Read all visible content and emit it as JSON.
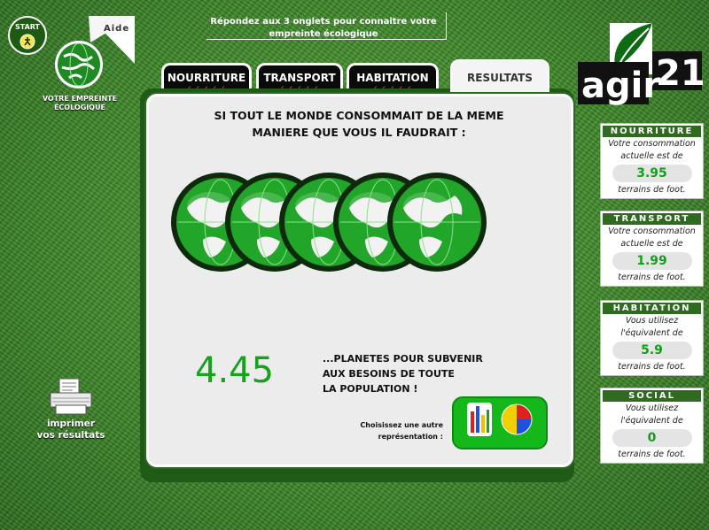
{
  "header": {
    "start_label": "START",
    "aide_label": "Aide",
    "empreinte_label": "VOTRE EMPREINTE ÉCOLOGIQUE",
    "instruction": "Répondez aux 3 onglets pour connaitre votre empreinte écologique"
  },
  "tabs": [
    {
      "label": "NOURRITURE",
      "checks": "✓✓✓✓✓"
    },
    {
      "label": "TRANSPORT",
      "checks": "✓✓✓✓✓"
    },
    {
      "label": "HABITATION",
      "checks": "✓✓✓✓✓"
    },
    {
      "label": "RESULTATS"
    }
  ],
  "main": {
    "title_line1": "SI TOUT LE MONDE CONSOMMAIT DE LA MEME",
    "title_line2": "MANIERE QUE VOUS IL FAUDRAIT :",
    "planets_value": "4.45",
    "planets_count": 4.45,
    "planets_text_1": "...PLANETES POUR SUBVENIR",
    "planets_text_2": "AUX BESOINS DE TOUTE",
    "planets_text_3": "LA POPULATION !",
    "choose_line1": "Choisissez une autre",
    "choose_line2": "représentation :"
  },
  "print": {
    "line1": "imprimer",
    "line2": "vos résultats"
  },
  "logo": {
    "text": "agir 21"
  },
  "cards": [
    {
      "title": "NOURRITURE",
      "line1": "Votre consommation",
      "line2": "actuelle est de",
      "value": "3.95",
      "unit": "terrains de foot."
    },
    {
      "title": "TRANSPORT",
      "line1": "Votre consommation",
      "line2": "actuelle est de",
      "value": "1.99",
      "unit": "terrains de foot."
    },
    {
      "title": "HABITATION",
      "line1": "Vous utilisez",
      "line2": "l'équivalent de",
      "value": "5.9",
      "unit": "terrains de foot."
    },
    {
      "title": "SOCIAL",
      "line1": "Vous utilisez",
      "line2": "l'équivalent de",
      "value": "0",
      "unit": "terrains de foot."
    }
  ],
  "colors": {
    "accent_green": "#16a21a",
    "tab_check": "#ff4a2a",
    "card_header": "#2f6a20"
  }
}
